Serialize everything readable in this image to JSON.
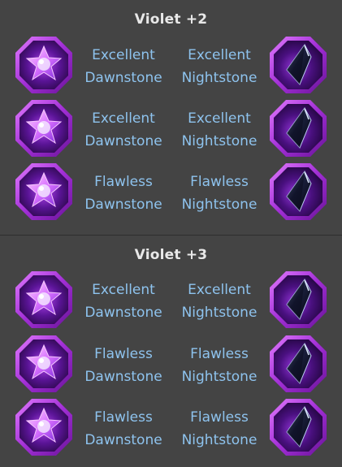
{
  "sections": [
    {
      "title": "Violet +2",
      "rows": [
        {
          "left": {
            "quality": "Excellent",
            "gem": "Dawnstone",
            "icon": "dawnstone-icon"
          },
          "right": {
            "quality": "Excellent",
            "gem": "Nightstone",
            "icon": "nightstone-icon"
          }
        },
        {
          "left": {
            "quality": "Excellent",
            "gem": "Dawnstone",
            "icon": "dawnstone-icon"
          },
          "right": {
            "quality": "Excellent",
            "gem": "Nightstone",
            "icon": "nightstone-icon"
          }
        },
        {
          "left": {
            "quality": "Flawless",
            "gem": "Dawnstone",
            "icon": "dawnstone-icon"
          },
          "right": {
            "quality": "Flawless",
            "gem": "Nightstone",
            "icon": "nightstone-icon"
          }
        }
      ]
    },
    {
      "title": "Violet +3",
      "rows": [
        {
          "left": {
            "quality": "Excellent",
            "gem": "Dawnstone",
            "icon": "dawnstone-icon"
          },
          "right": {
            "quality": "Excellent",
            "gem": "Nightstone",
            "icon": "nightstone-icon"
          }
        },
        {
          "left": {
            "quality": "Flawless",
            "gem": "Dawnstone",
            "icon": "dawnstone-icon"
          },
          "right": {
            "quality": "Flawless",
            "gem": "Nightstone",
            "icon": "nightstone-icon"
          }
        },
        {
          "left": {
            "quality": "Flawless",
            "gem": "Dawnstone",
            "icon": "dawnstone-icon"
          },
          "right": {
            "quality": "Flawless",
            "gem": "Nightstone",
            "icon": "nightstone-icon"
          }
        }
      ]
    }
  ],
  "colors": {
    "background": "#444444",
    "title_text": "#e8e8e8",
    "label_text": "#8ec3ee",
    "frame_purple": "#9a2bd0",
    "gem_glow": "#c050ff"
  }
}
